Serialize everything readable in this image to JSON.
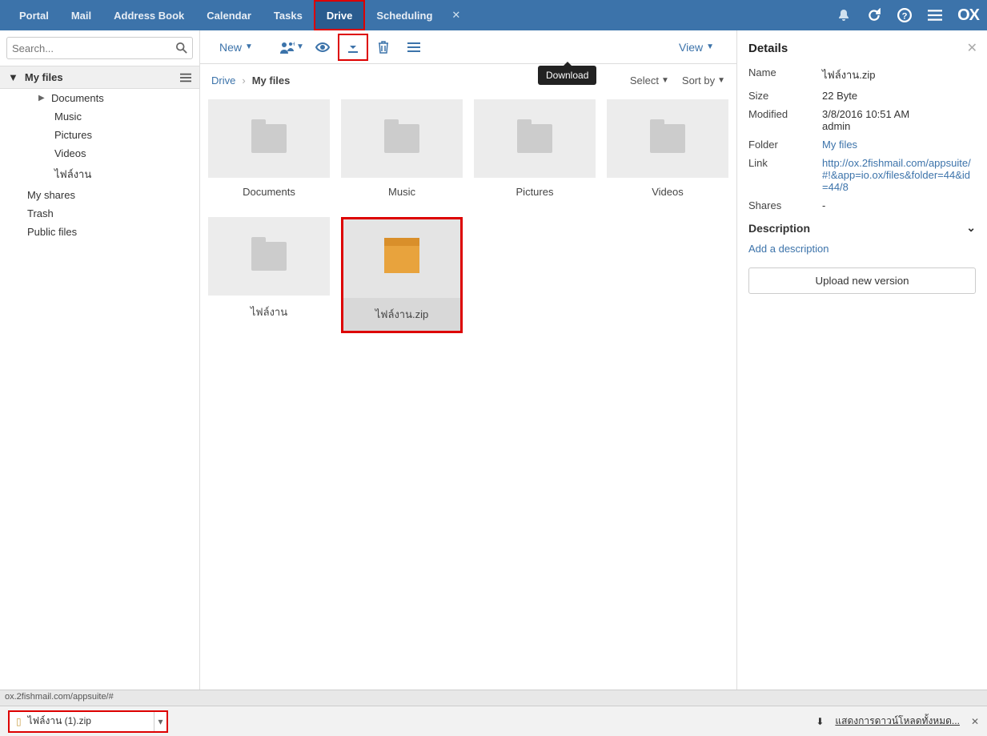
{
  "nav": {
    "items": [
      "Portal",
      "Mail",
      "Address Book",
      "Calendar",
      "Tasks",
      "Drive",
      "Scheduling"
    ],
    "active": "Drive"
  },
  "search": {
    "placeholder": "Search..."
  },
  "tree": {
    "root": "My files",
    "children": [
      "Documents",
      "Music",
      "Pictures",
      "Videos",
      "ไฟล์งาน"
    ],
    "top": [
      "My shares",
      "Trash",
      "Public files"
    ]
  },
  "toolbar": {
    "new_label": "New",
    "view_label": "View",
    "download_tooltip": "Download"
  },
  "breadcrumb": {
    "root": "Drive",
    "current": "My files",
    "select_label": "Select",
    "sort_label": "Sort by"
  },
  "tiles": [
    {
      "label": "Documents",
      "type": "folder"
    },
    {
      "label": "Music",
      "type": "folder"
    },
    {
      "label": "Pictures",
      "type": "folder"
    },
    {
      "label": "Videos",
      "type": "folder"
    },
    {
      "label": "ไฟล์งาน",
      "type": "folder"
    },
    {
      "label": "ไฟล์งาน.zip",
      "type": "zip",
      "selected": true
    }
  ],
  "details": {
    "title": "Details",
    "name_k": "Name",
    "name_v": "ไฟล์งาน.zip",
    "size_k": "Size",
    "size_v": "22 Byte",
    "mod_k": "Modified",
    "mod_v": "3/8/2016 10:51 AM",
    "mod_by": "admin",
    "folder_k": "Folder",
    "folder_v": "My files",
    "link_k": "Link",
    "link_v": "http://ox.2fishmail.com/appsuite/#!&app=io.ox/files&folder=44&id=44/8",
    "shares_k": "Shares",
    "shares_v": "-",
    "desc_title": "Description",
    "add_desc": "Add a description",
    "upload_btn": "Upload new version"
  },
  "statusbar": {
    "text": "ox.2fishmail.com/appsuite/#"
  },
  "dlbar": {
    "file": "ไฟล์งาน (1).zip",
    "showall": "แสดงการดาวน์โหลดทั้งหมด..."
  }
}
